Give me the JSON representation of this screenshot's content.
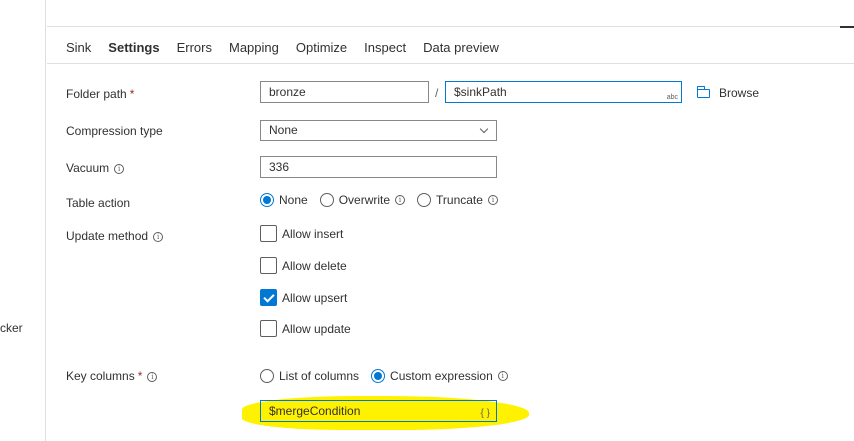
{
  "left_stub_text": "cker",
  "tabs": [
    "Sink",
    "Settings",
    "Errors",
    "Mapping",
    "Optimize",
    "Inspect",
    "Data preview"
  ],
  "active_tab": "Settings",
  "form": {
    "folder_path": {
      "label": "Folder path",
      "required_mark": "*",
      "container_value": "bronze",
      "separator": "/",
      "path_value": "$sinkPath",
      "path_type_badge": "abc",
      "browse_label": "Browse"
    },
    "compression": {
      "label": "Compression type",
      "value": "None"
    },
    "vacuum": {
      "label": "Vacuum",
      "value": "336"
    },
    "table_action": {
      "label": "Table action",
      "options": [
        "None",
        "Overwrite",
        "Truncate"
      ],
      "selected": "None"
    },
    "update_method": {
      "label": "Update method",
      "options": [
        {
          "label": "Allow insert",
          "checked": false
        },
        {
          "label": "Allow delete",
          "checked": false
        },
        {
          "label": "Allow upsert",
          "checked": true
        },
        {
          "label": "Allow update",
          "checked": false
        }
      ]
    },
    "key_columns": {
      "label": "Key columns",
      "required_mark": "*",
      "options": [
        "List of columns",
        "Custom expression"
      ],
      "selected": "Custom expression",
      "expression_value": "$mergeCondition",
      "expression_badge": "{ }"
    }
  },
  "colors": {
    "accent": "#0078d4",
    "highlight": "#fff200",
    "required": "#a4262c"
  },
  "icons": {
    "info": "info-circle-icon",
    "browse": "folder-icon",
    "dropdown": "chevron-down-icon"
  }
}
